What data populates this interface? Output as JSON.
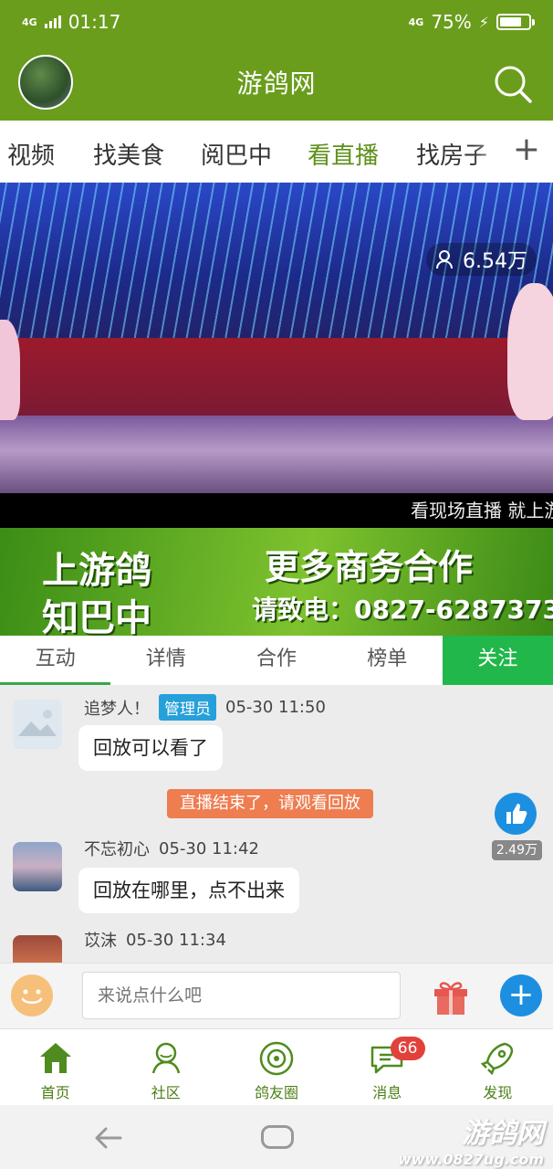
{
  "status_bar": {
    "time": "01:17",
    "net_left": "4G",
    "net_right": "4G",
    "battery": "75%",
    "battery_level": 0.75
  },
  "header": {
    "title": "游鸽网"
  },
  "category_tabs": [
    {
      "label": "视频"
    },
    {
      "label": "找美食"
    },
    {
      "label": "阅巴中"
    },
    {
      "label": "看直播",
      "active": true
    },
    {
      "label": "找房子"
    }
  ],
  "category_add": "+",
  "video": {
    "viewers": "6.54万",
    "marquee": "看现场直播 就上游"
  },
  "banner": {
    "line1": "上游鸽",
    "line2": "知巴中",
    "line3": "更多商务合作",
    "line4": "请致电：0827-6287373"
  },
  "section_tabs": [
    {
      "label": "互动",
      "active": true
    },
    {
      "label": "详情"
    },
    {
      "label": "合作"
    },
    {
      "label": "榜单"
    },
    {
      "label": "关注",
      "highlight": true
    }
  ],
  "messages": [
    {
      "name": "追梦人！",
      "role": "管理员",
      "time": "05-30 11:50",
      "text": "回放可以看了"
    },
    {
      "name": "不忘初心",
      "time": "05-30 11:42",
      "text": "回放在哪里，点不出来"
    },
    {
      "name": "苡沫",
      "time": "05-30 11:34",
      "text": ""
    }
  ],
  "system_notice": "直播结束了，请观看回放",
  "likes": "2.49万",
  "input": {
    "placeholder": "来说点什么吧"
  },
  "bottom_nav": [
    {
      "label": "首页",
      "icon": "home-icon"
    },
    {
      "label": "社区",
      "icon": "community-icon"
    },
    {
      "label": "鸽友圈",
      "icon": "circle-icon"
    },
    {
      "label": "消息",
      "icon": "message-icon",
      "badge": "66"
    },
    {
      "label": "发现",
      "icon": "rocket-icon"
    }
  ],
  "watermark": {
    "brand": "游鸽网",
    "url": "www.0827ug.com"
  }
}
